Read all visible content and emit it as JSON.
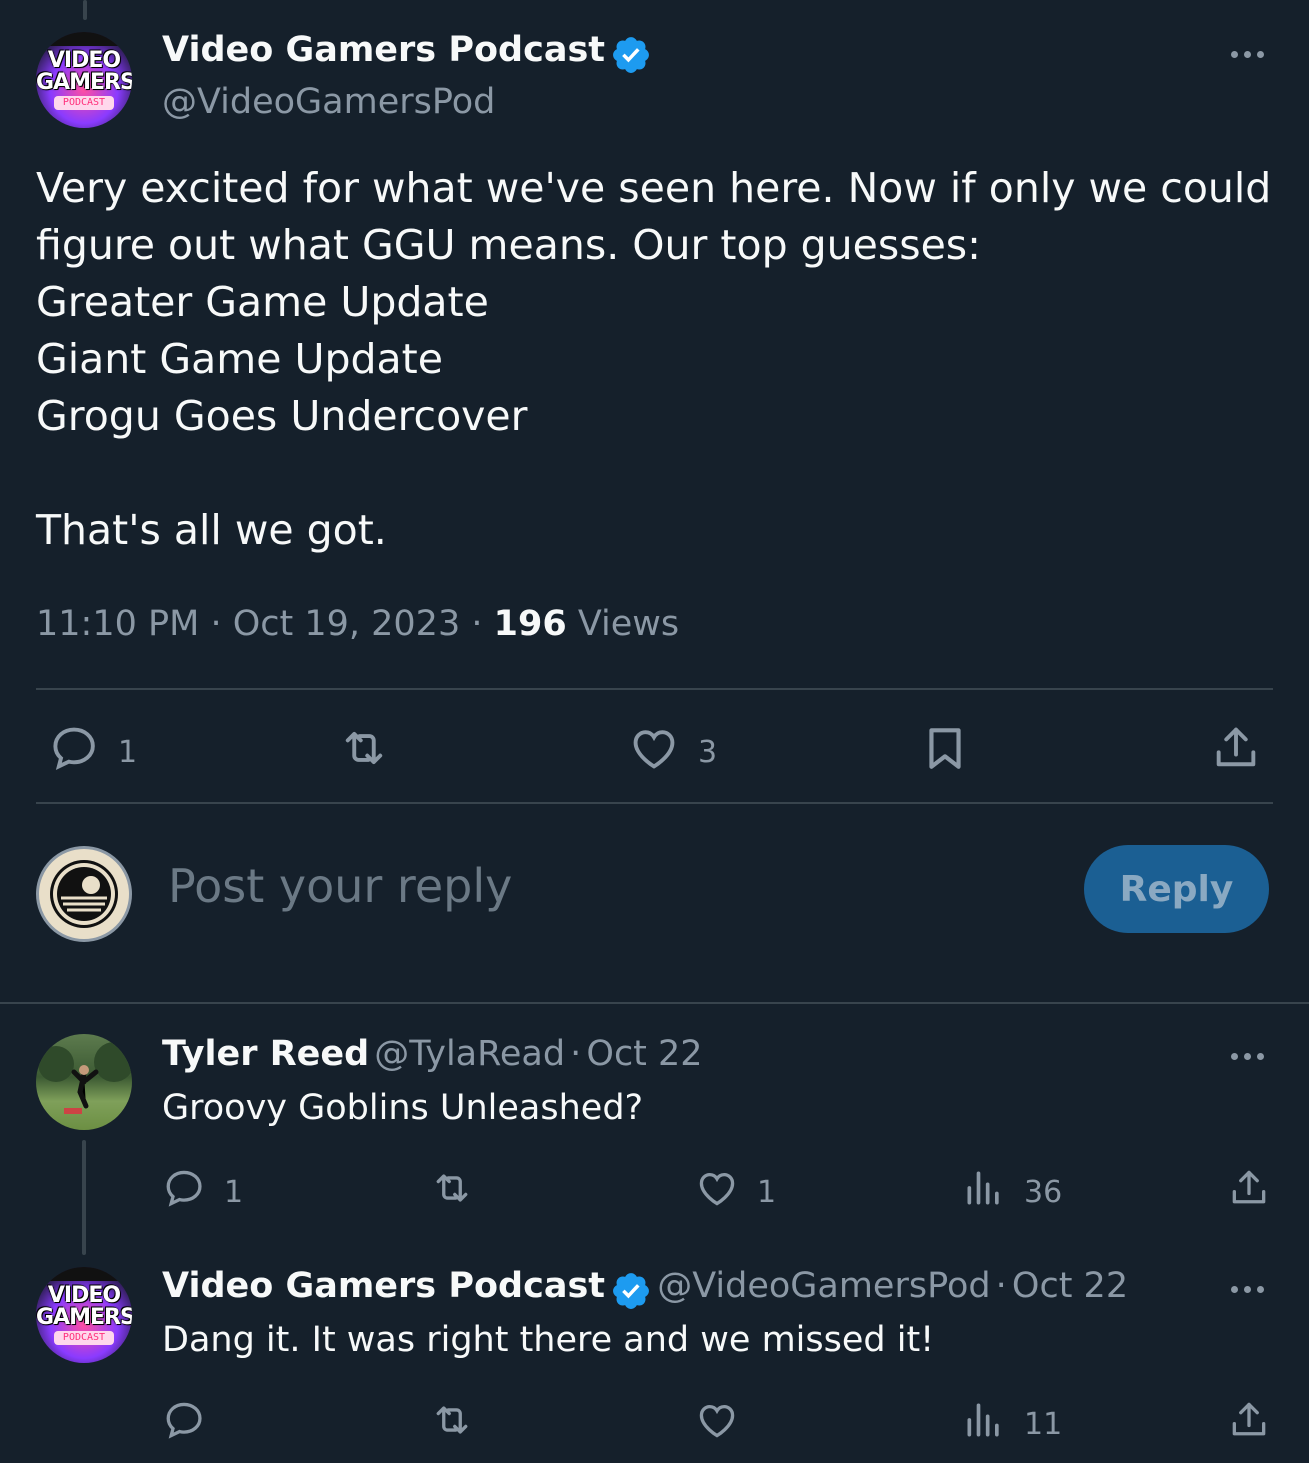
{
  "main_post": {
    "author_name": "Video Gamers Podcast",
    "author_handle": "@VideoGamersPod",
    "avatar_logo_top": "VIDEO",
    "avatar_logo_mid": "GAMERS",
    "avatar_logo_sub": "PODCAST",
    "text": "Very excited for what we've seen here. Now if only we could\nfigure out what GGU means. Our top guesses:\nGreater Game Update\nGiant Game Update\nGrogu Goes Undercover\n\nThat's all we got.",
    "time": "11:10 PM",
    "date": "Oct 19, 2023",
    "views_count": "196",
    "views_label": "Views",
    "sep": "·",
    "replies": "1",
    "likes": "3"
  },
  "composer": {
    "placeholder": "Post your reply",
    "button_label": "Reply"
  },
  "replies": [
    {
      "author_name": "Tyler Reed",
      "author_handle": "@TylaRead",
      "date": "Oct 22",
      "text": "Groovy Goblins Unleashed?",
      "replies": "1",
      "likes": "1",
      "views": "36"
    },
    {
      "author_name": "Video Gamers Podcast",
      "author_handle": "@VideoGamersPod",
      "date": "Oct 22",
      "text": "Dang it. It was right there and we missed it!",
      "views": "11"
    }
  ],
  "colors": {
    "background": "#15202b",
    "accent": "#1d9bf0",
    "muted": "#8b98a5",
    "divider": "#38444d"
  }
}
